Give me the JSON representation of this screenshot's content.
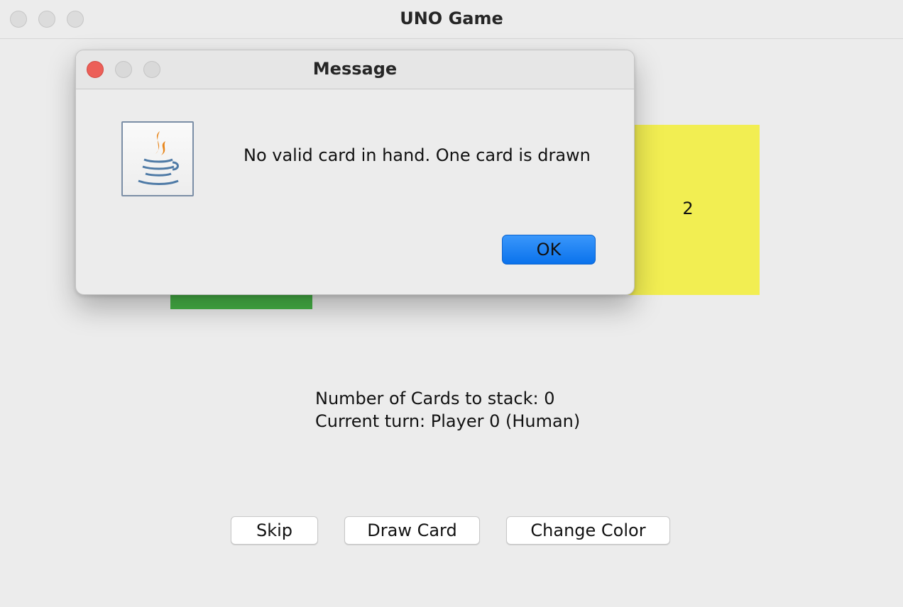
{
  "window": {
    "title": "UNO Game"
  },
  "game": {
    "top_card_label": "2",
    "top_card_color": "#f2ee52",
    "hand_card_color": "#46b246",
    "stack_text": "Number of Cards to stack: 0",
    "turn_text": "Current turn: Player 0 (Human)"
  },
  "buttons": {
    "skip": "Skip",
    "draw_card": "Draw Card",
    "change_color": "Change Color"
  },
  "dialog": {
    "title": "Message",
    "icon": "java-icon",
    "message": "No valid card in hand. One card is drawn",
    "ok_label": "OK",
    "ok_color": "#0a72ec"
  }
}
